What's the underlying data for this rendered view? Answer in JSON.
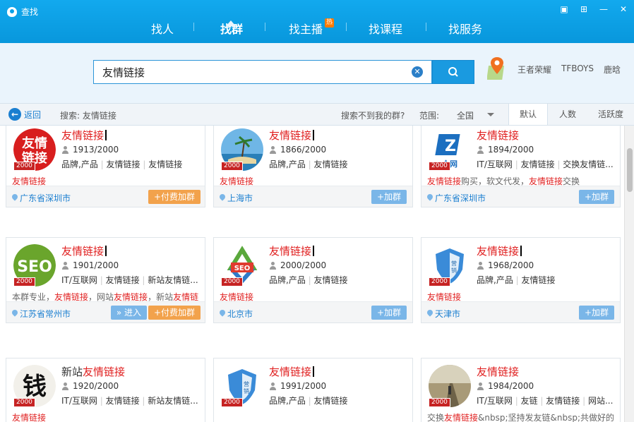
{
  "window": {
    "title": "查找"
  },
  "nav": {
    "items": [
      "找人",
      "找群",
      "找主播",
      "找课程",
      "找服务"
    ],
    "active": "找群",
    "hot_badge": "热"
  },
  "search": {
    "value": "友情链接",
    "hot_words": [
      "王者荣耀",
      "TFBOYS",
      "鹿晗"
    ]
  },
  "filter": {
    "back": "返回",
    "keyword_label": "搜索: 友情链接",
    "not_found": "搜索不到我的群?",
    "range_label": "范围:",
    "range_value": "全国",
    "sorts": [
      "默认",
      "人数",
      "活跃度"
    ],
    "active_sort": "默认"
  },
  "colors": {
    "accent": "#0aa1e8",
    "highlight": "#e02020",
    "link": "#1b7fd0",
    "pay": "#f2a24c",
    "join": "#7ab6e8"
  },
  "buttons": {
    "join": "+加群",
    "pay_join": "+付费加群",
    "enter": "» 进入"
  },
  "groups": [
    {
      "prefix": "",
      "name": "友情链接",
      "count": "1913/2000",
      "level": "2000",
      "tags": [
        "品牌,产品",
        "友情链接",
        "友情链接"
      ],
      "desc_html": "<span class='hl'>友情链接</span>",
      "location": "广东省深圳市",
      "action": "pay",
      "avatar": "red-link"
    },
    {
      "prefix": "",
      "name": "友情链接",
      "count": "1866/2000",
      "level": "2000",
      "tags": [
        "品牌,产品",
        "友情链接"
      ],
      "desc_html": "<span class='hl'>友情链接</span>",
      "location": "上海市",
      "action": "join",
      "avatar": "beach"
    },
    {
      "prefix": "",
      "name": "友情链接",
      "count": "1894/2000",
      "level": "2000",
      "tags": [
        "IT/互联网",
        "友情链接",
        "交换友情链..."
      ],
      "desc_html": "<span class='hl'>友情链接</span>购买，软文代发，<span class='hl'>友情链接</span>交换",
      "location": "广东省深圳市",
      "action": "join",
      "avatar": "net"
    },
    {
      "prefix": "",
      "name": "友情链接",
      "count": "1901/2000",
      "level": "2000",
      "tags": [
        "IT/互联网",
        "友情链接",
        "新站友情链..."
      ],
      "desc_html": "本群专业，<span class='hl'>友情链接</span>，网站<span class='hl'>友情链接</span>，新站<span class='hl'>友情链接</span>，机械<span class='hl'>友情链接</span>，新闻<span class='hl'>友情链接</span>。门户<span class='hl'>友情链</span>...",
      "location": "江苏省常州市",
      "action": "enter-pay",
      "avatar": "seo-green"
    },
    {
      "prefix": "",
      "name": "友情链接",
      "count": "2000/2000",
      "level": "2000",
      "tags": [
        "品牌,产品",
        "友情链接"
      ],
      "desc_html": "<span class='hl'>友情链接</span>",
      "location": "北京市",
      "action": "join",
      "avatar": "seo-arrows"
    },
    {
      "prefix": "",
      "name": "友情链接",
      "count": "1968/2000",
      "level": "2000",
      "tags": [
        "品牌,产品",
        "友情链接"
      ],
      "desc_html": "<span class='hl'>友情链接</span>",
      "location": "天津市",
      "action": "join",
      "avatar": "shield"
    },
    {
      "prefix": "新站",
      "name": "友情链接",
      "count": "1920/2000",
      "level": "2000",
      "tags": [
        "IT/互联网",
        "友情链接",
        "新站友情链..."
      ],
      "desc_html": "<span class='hl'>友情链接</span>",
      "location": "",
      "action": "none",
      "avatar": "money"
    },
    {
      "prefix": "",
      "name": "友情链接",
      "count": "1991/2000",
      "level": "2000",
      "tags": [
        "品牌,产品",
        "友情链接"
      ],
      "desc_html": "",
      "location": "",
      "action": "none",
      "avatar": "shield"
    },
    {
      "prefix": "",
      "name": "友情链接",
      "count": "1984/2000",
      "level": "2000",
      "tags": [
        "IT/互联网",
        "友链",
        "友情链接",
        "网站..."
      ],
      "desc_html": "交换<span class='hl'>友情链接</span>&amp;nbsp;坚持发友链&amp;nbsp;共做好的",
      "location": "",
      "action": "none",
      "avatar": "road"
    }
  ]
}
